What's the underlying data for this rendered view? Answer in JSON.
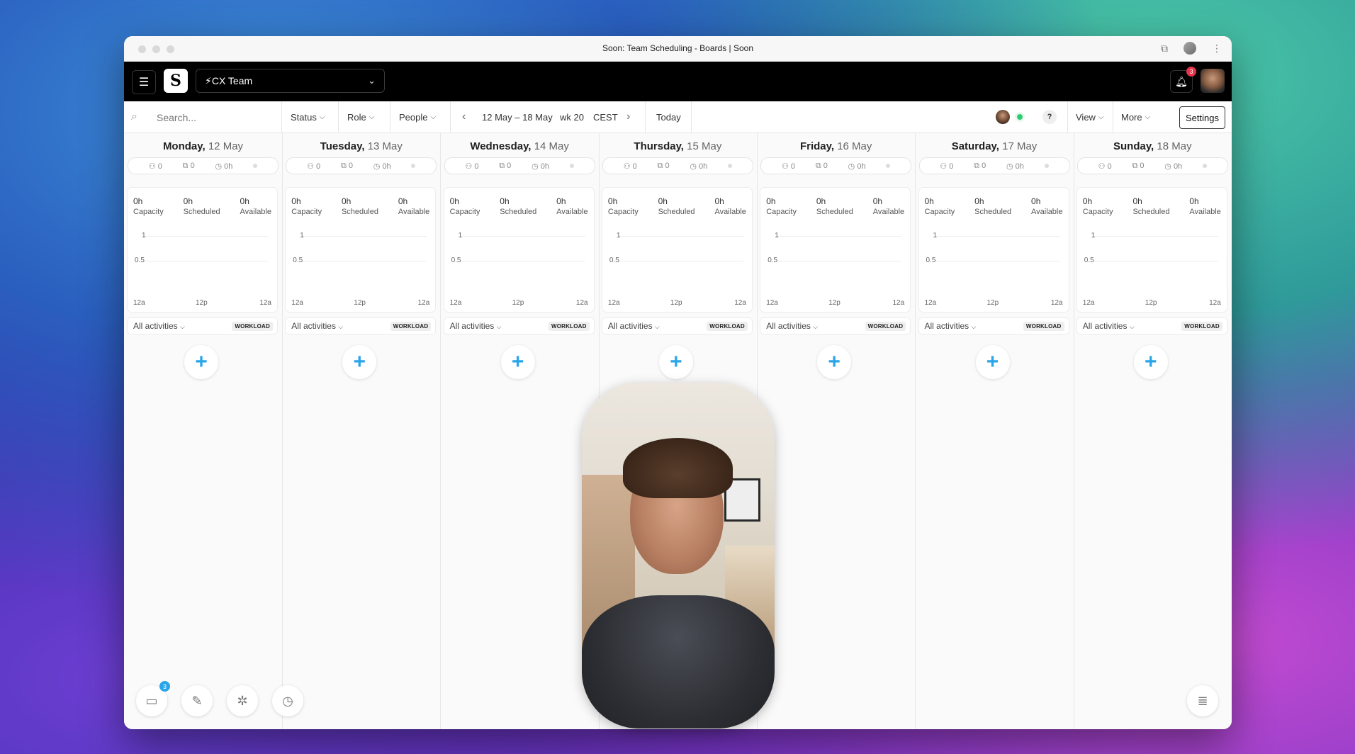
{
  "window": {
    "title": "Soon: Team Scheduling - Boards | Soon"
  },
  "appbar": {
    "team_name": "⚡CX Team",
    "notification_count": "3",
    "logo": "S"
  },
  "toolbar": {
    "search_placeholder": "Search...",
    "status_label": "Status",
    "role_label": "Role",
    "people_label": "People",
    "date_range": "12 May – 18 May",
    "week": "wk 20",
    "timezone": "CEST",
    "today_label": "Today",
    "help_label": "?",
    "view_label": "View",
    "more_label": "More",
    "settings_label": "Settings"
  },
  "days": [
    {
      "weekday": "Monday,",
      "date": "12 May"
    },
    {
      "weekday": "Tuesday,",
      "date": "13 May"
    },
    {
      "weekday": "Wednesday,",
      "date": "14 May"
    },
    {
      "weekday": "Thursday,",
      "date": "15 May"
    },
    {
      "weekday": "Friday,",
      "date": "16 May"
    },
    {
      "weekday": "Saturday,",
      "date": "17 May"
    },
    {
      "weekday": "Sunday,",
      "date": "18 May"
    }
  ],
  "day_stats": {
    "people": "0",
    "shifts": "0",
    "hours": "0h"
  },
  "metrics": {
    "capacity_value": "0h",
    "capacity_label": "Capacity",
    "scheduled_value": "0h",
    "scheduled_label": "Scheduled",
    "available_value": "0h",
    "available_label": "Available"
  },
  "chart": {
    "y_ticks": [
      "1",
      "0.5"
    ],
    "x_ticks": [
      "12a",
      "12p",
      "12a"
    ]
  },
  "activities": {
    "label": "All activities",
    "badge": "WORKLOAD"
  },
  "bottom": {
    "inbox_count": "3"
  },
  "icons": [
    "menu-icon",
    "search-icon",
    "chevron-down-icon",
    "chevron-left-icon",
    "chevron-right-icon",
    "bell-icon",
    "people-icon",
    "copy-icon",
    "clock-icon",
    "plus-icon",
    "inbox-icon",
    "pencil-icon",
    "sparkle-icon",
    "list-icon"
  ]
}
